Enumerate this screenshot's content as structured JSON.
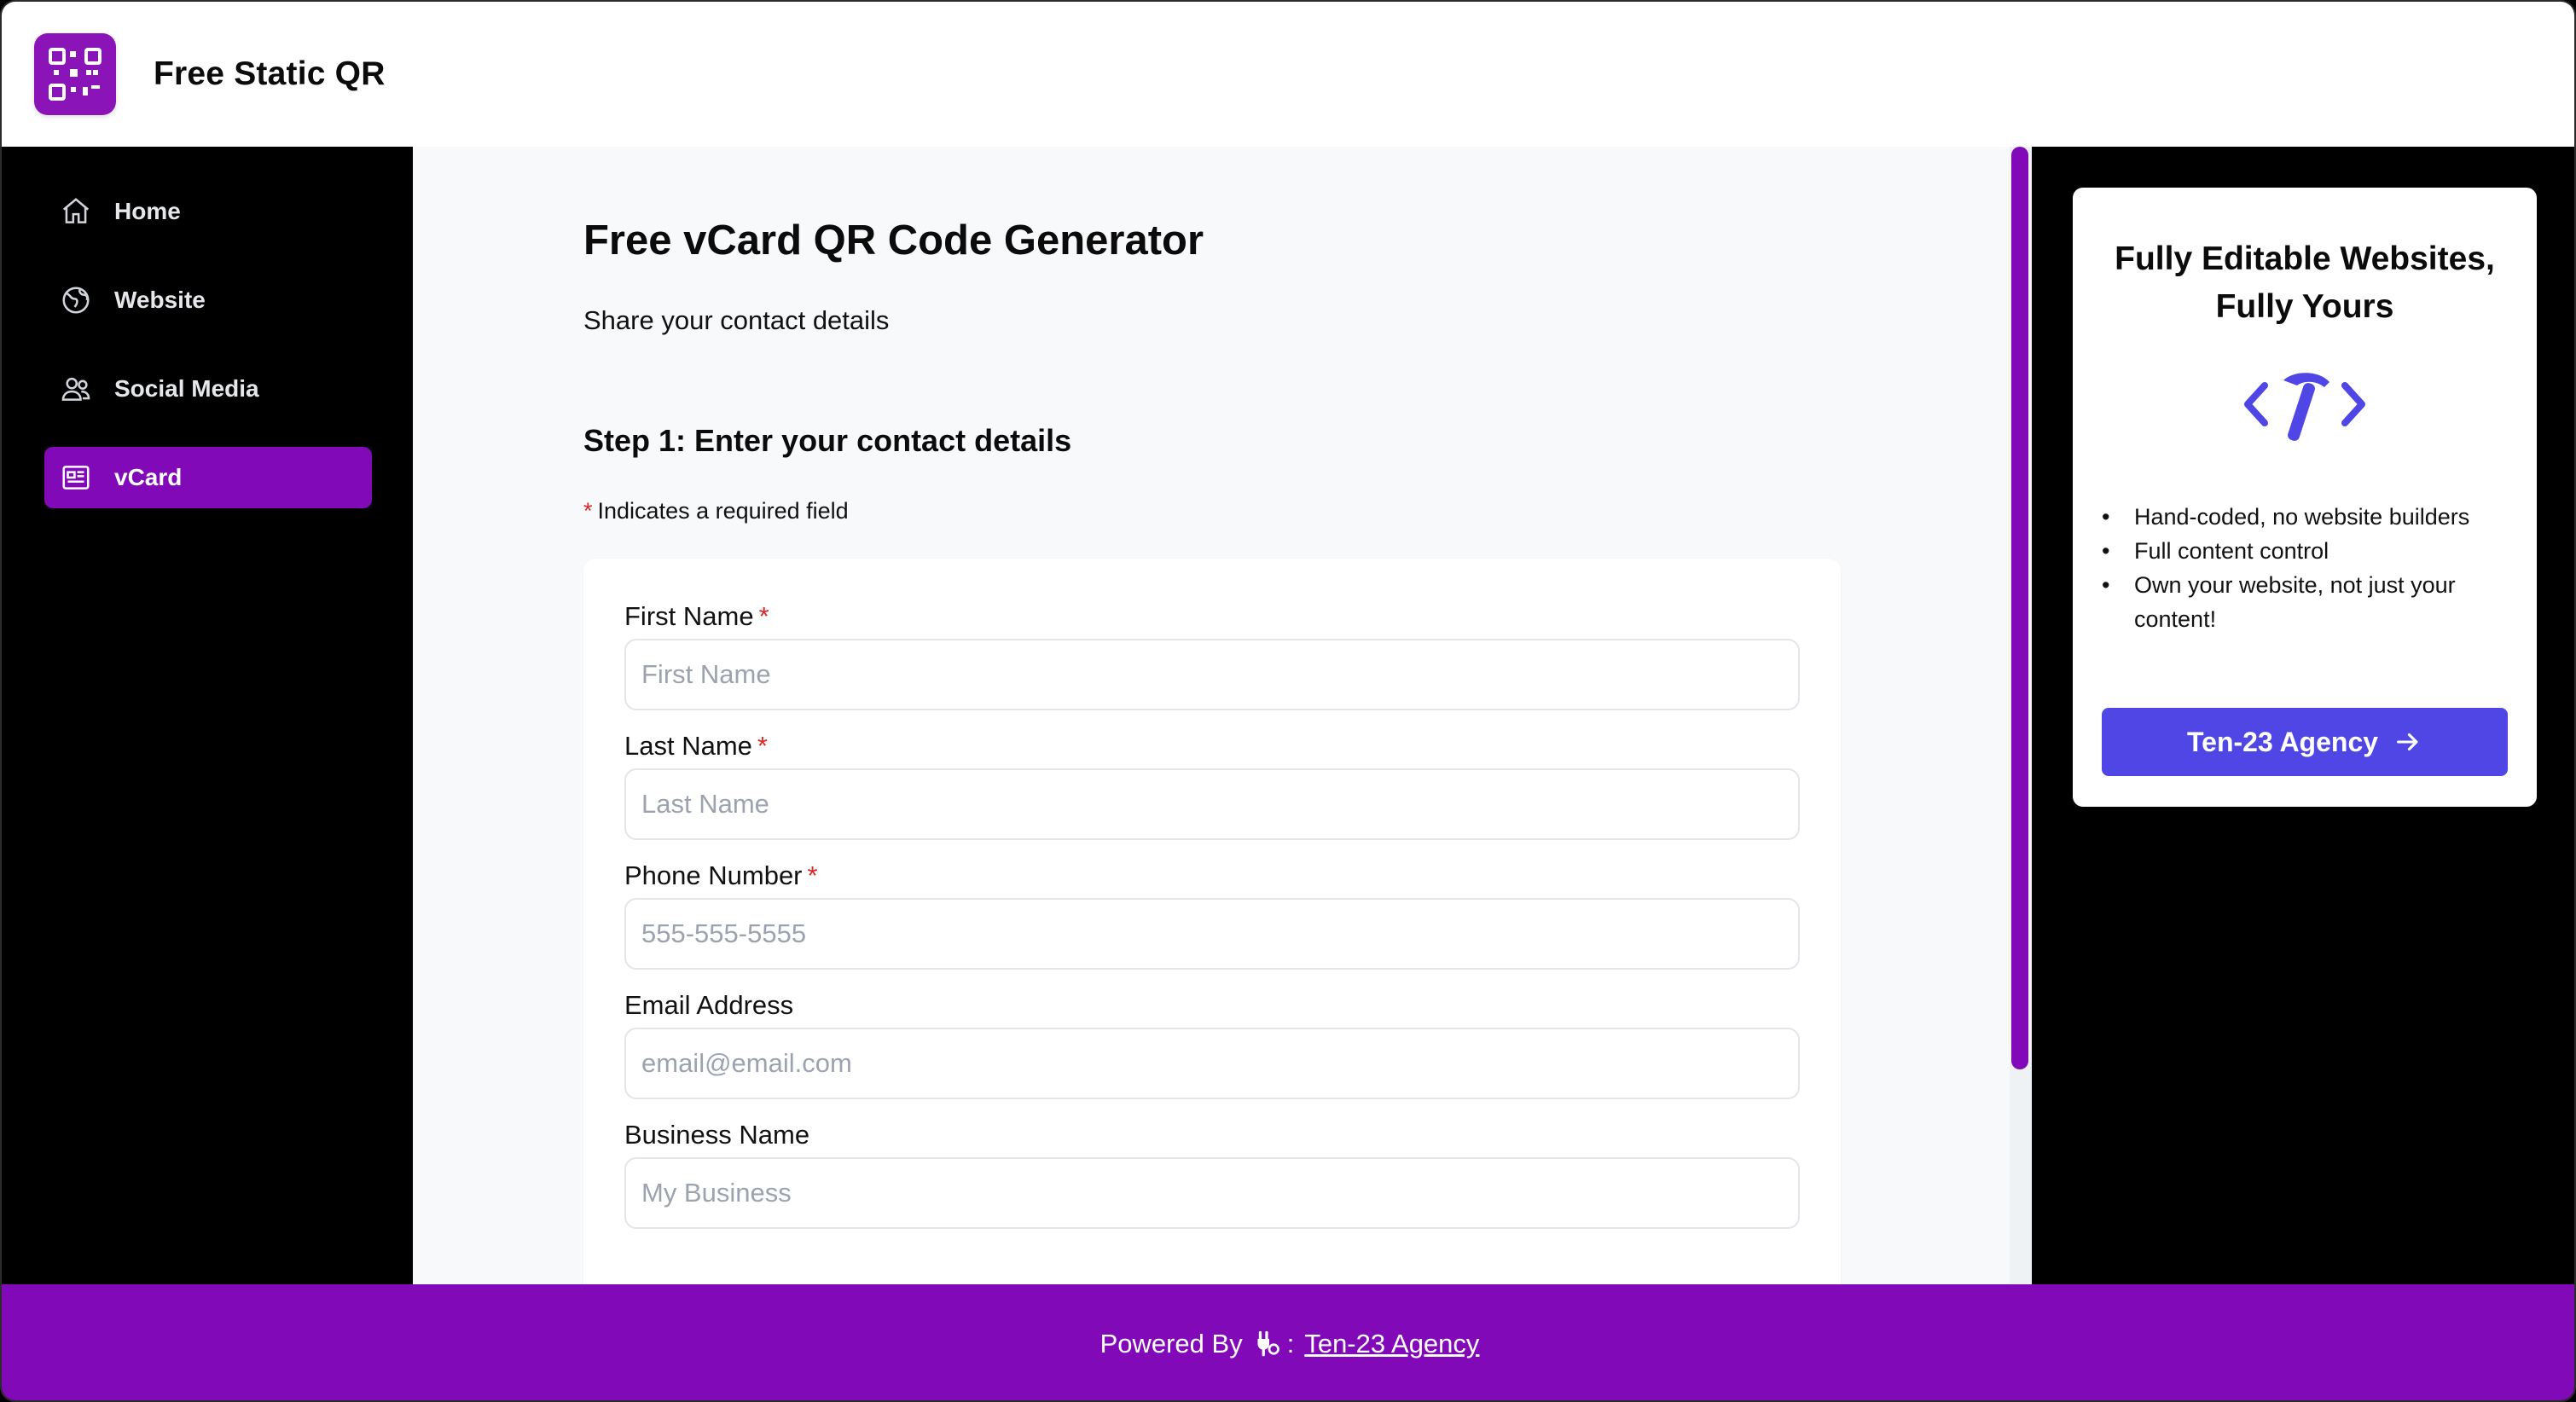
{
  "header": {
    "title": "Free Static QR"
  },
  "sidebar": {
    "items": [
      {
        "label": "Home",
        "icon": "home-icon"
      },
      {
        "label": "Website",
        "icon": "globe-icon"
      },
      {
        "label": "Social Media",
        "icon": "users-icon"
      },
      {
        "label": "vCard",
        "icon": "id-card-icon",
        "active": true
      }
    ]
  },
  "main": {
    "title": "Free vCard QR Code Generator",
    "subtitle": "Share your contact details",
    "step_title": "Step 1: Enter your contact details",
    "required_star": "*",
    "required_note": "Indicates a required field",
    "fields": [
      {
        "label": "First Name",
        "required": "*",
        "placeholder": "First Name"
      },
      {
        "label": "Last Name",
        "required": "*",
        "placeholder": "Last Name"
      },
      {
        "label": "Phone Number",
        "required": "*",
        "placeholder": "555-555-5555"
      },
      {
        "label": "Email Address",
        "placeholder": "email@email.com"
      },
      {
        "label": "Business Name",
        "placeholder": "My Business"
      }
    ]
  },
  "promo": {
    "title": "Fully Editable Websites, Fully Yours",
    "bullets": [
      "Hand-coded, no website builders",
      "Full content control",
      "Own your website, not just your content!"
    ],
    "button_label": "Ten-23 Agency",
    "accent_color": "#4f46e5"
  },
  "footer": {
    "powered_by": "Powered By",
    "separator": ":",
    "link_label": "Ten-23 Agency"
  },
  "colors": {
    "brand": "#8209b8",
    "required": "#dc2626"
  }
}
